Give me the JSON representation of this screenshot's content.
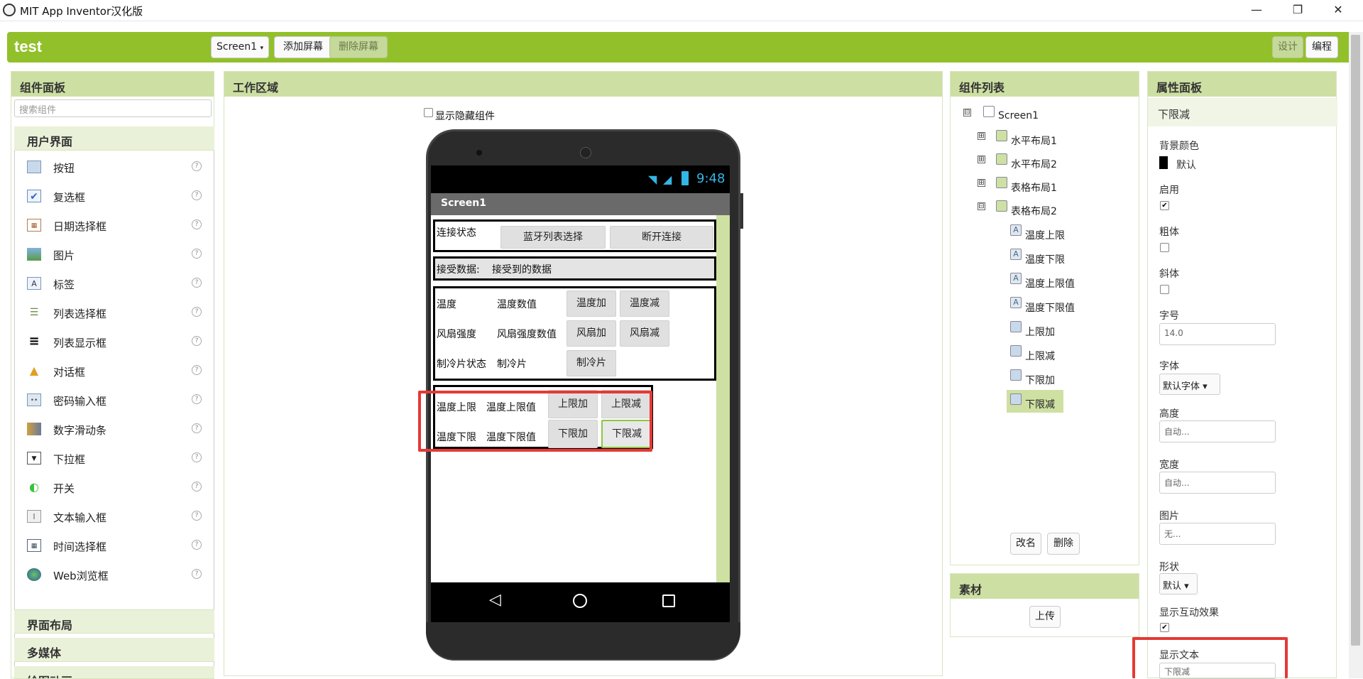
{
  "window": {
    "title": "MIT App Inventor汉化版",
    "minimize": "—",
    "maximize": "❐",
    "close": "✕"
  },
  "topbar": {
    "project": "test",
    "screen_select": "Screen1",
    "add_screen": "添加屏幕",
    "remove_screen": "删除屏幕",
    "designer": "设计",
    "blocks": "编程"
  },
  "palette": {
    "title": "组件面板",
    "search_placeholder": "搜索组件",
    "category": "用户界面",
    "items": [
      {
        "label": "按钮",
        "icon": "button-icon"
      },
      {
        "label": "复选框",
        "icon": "checkbox-icon"
      },
      {
        "label": "日期选择框",
        "icon": "datepicker-icon"
      },
      {
        "label": "图片",
        "icon": "image-icon"
      },
      {
        "label": "标签",
        "icon": "label-icon"
      },
      {
        "label": "列表选择框",
        "icon": "listpicker-icon"
      },
      {
        "label": "列表显示框",
        "icon": "listview-icon"
      },
      {
        "label": "对话框",
        "icon": "notifier-icon"
      },
      {
        "label": "密码输入框",
        "icon": "password-icon"
      },
      {
        "label": "数字滑动条",
        "icon": "slider-icon"
      },
      {
        "label": "下拉框",
        "icon": "spinner-icon"
      },
      {
        "label": "开关",
        "icon": "switch-icon"
      },
      {
        "label": "文本输入框",
        "icon": "textbox-icon"
      },
      {
        "label": "时间选择框",
        "icon": "timepicker-icon"
      },
      {
        "label": "Web浏览框",
        "icon": "webviewer-icon"
      }
    ],
    "help": "?",
    "categories_below": [
      "界面布局",
      "多媒体",
      "绘图动画"
    ]
  },
  "viewer": {
    "title": "工作区域",
    "show_hidden": "显示隐藏组件",
    "time": "9:48",
    "screen_title": "Screen1",
    "row1": {
      "status_label": "连接状态",
      "bt_list": "蓝牙列表选择",
      "disconnect": "断开连接"
    },
    "row2": {
      "recv_label": "接受数据:",
      "recv_value": "接受到的数据"
    },
    "table1": [
      {
        "name": "温度",
        "value": "温度数值",
        "b1": "温度加",
        "b2": "温度减"
      },
      {
        "name": "风扇强度",
        "value": "风扇强度数值",
        "b1": "风扇加",
        "b2": "风扇减"
      },
      {
        "name": "制冷片状态",
        "value": "制冷片",
        "b1": "制冷片",
        "b2": ""
      }
    ],
    "table2": [
      {
        "name": "温度上限",
        "value": "温度上限值",
        "b1": "上限加",
        "b2": "上限减"
      },
      {
        "name": "温度下限",
        "value": "温度下限值",
        "b1": "下限加",
        "b2": "下限减"
      }
    ]
  },
  "components": {
    "title": "组件列表",
    "tree": [
      {
        "label": "Screen1",
        "expander": "⊟"
      },
      {
        "label": "水平布局1",
        "expander": "⊞"
      },
      {
        "label": "水平布局2",
        "expander": "⊞"
      },
      {
        "label": "表格布局1",
        "expander": "⊞"
      },
      {
        "label": "表格布局2",
        "expander": "⊟"
      },
      {
        "label": "温度上限"
      },
      {
        "label": "温度下限"
      },
      {
        "label": "温度上限值"
      },
      {
        "label": "温度下限值"
      },
      {
        "label": "上限加"
      },
      {
        "label": "上限减"
      },
      {
        "label": "下限加"
      },
      {
        "label": "下限减"
      }
    ],
    "rename": "改名",
    "delete": "删除"
  },
  "media": {
    "title": "素材",
    "upload": "上传"
  },
  "properties": {
    "title": "属性面板",
    "component": "下限减",
    "bg_color_label": "背景颜色",
    "bg_color_value": "默认",
    "enabled_label": "启用",
    "enabled": "✔",
    "bold_label": "粗体",
    "italic_label": "斜体",
    "fontsize_label": "字号",
    "fontsize_value": "14.0",
    "font_label": "字体",
    "font_value": "默认字体 ▾",
    "height_label": "高度",
    "height_value": "自动...",
    "width_label": "宽度",
    "width_value": "自动...",
    "image_label": "图片",
    "image_value": "无...",
    "shape_label": "形状",
    "shape_value": "默认 ▾",
    "feedback_label": "显示互动效果",
    "feedback": "✔",
    "text_label": "显示文本",
    "text_value": "下限减"
  }
}
